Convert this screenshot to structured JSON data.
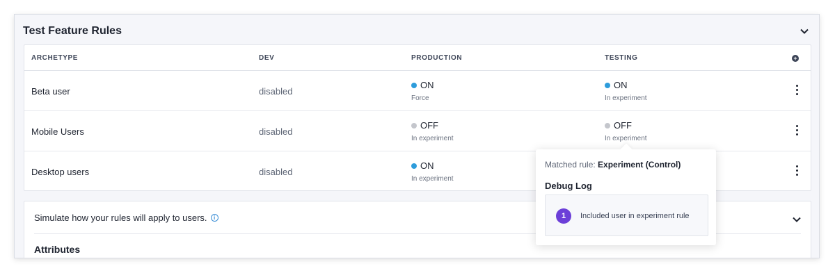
{
  "panel": {
    "title": "Test Feature Rules"
  },
  "table": {
    "headers": {
      "archetype": "ARCHETYPE",
      "dev": "DEV",
      "production": "PRODUCTION",
      "testing": "TESTING"
    },
    "rows": [
      {
        "name": "Beta user",
        "dev": "disabled",
        "production": {
          "state": "ON",
          "detail": "Force",
          "color": "#2d9cdb"
        },
        "testing": {
          "state": "ON",
          "detail": "In experiment",
          "color": "#2d9cdb"
        }
      },
      {
        "name": "Mobile Users",
        "dev": "disabled",
        "production": {
          "state": "OFF",
          "detail": "In experiment",
          "color": "#c4c6cc"
        },
        "testing": {
          "state": "OFF",
          "detail": "In experiment",
          "color": "#c4c6cc"
        }
      },
      {
        "name": "Desktop users",
        "dev": "disabled",
        "production": {
          "state": "ON",
          "detail": "In experiment",
          "color": "#2d9cdb"
        }
      }
    ]
  },
  "simulate": {
    "text": "Simulate how your rules will apply to users.",
    "attributes_heading": "Attributes"
  },
  "popover": {
    "matched_label": "Matched rule:",
    "matched_value": "Experiment (Control)",
    "debug_title": "Debug Log",
    "log": [
      {
        "step": "1",
        "text": "Included user in experiment rule"
      }
    ],
    "step_color": "#6c3fd8"
  },
  "icons": {
    "collapse": "chevron-down-icon",
    "add": "plus-circle-icon",
    "more": "kebab-icon",
    "info": "info-icon"
  }
}
